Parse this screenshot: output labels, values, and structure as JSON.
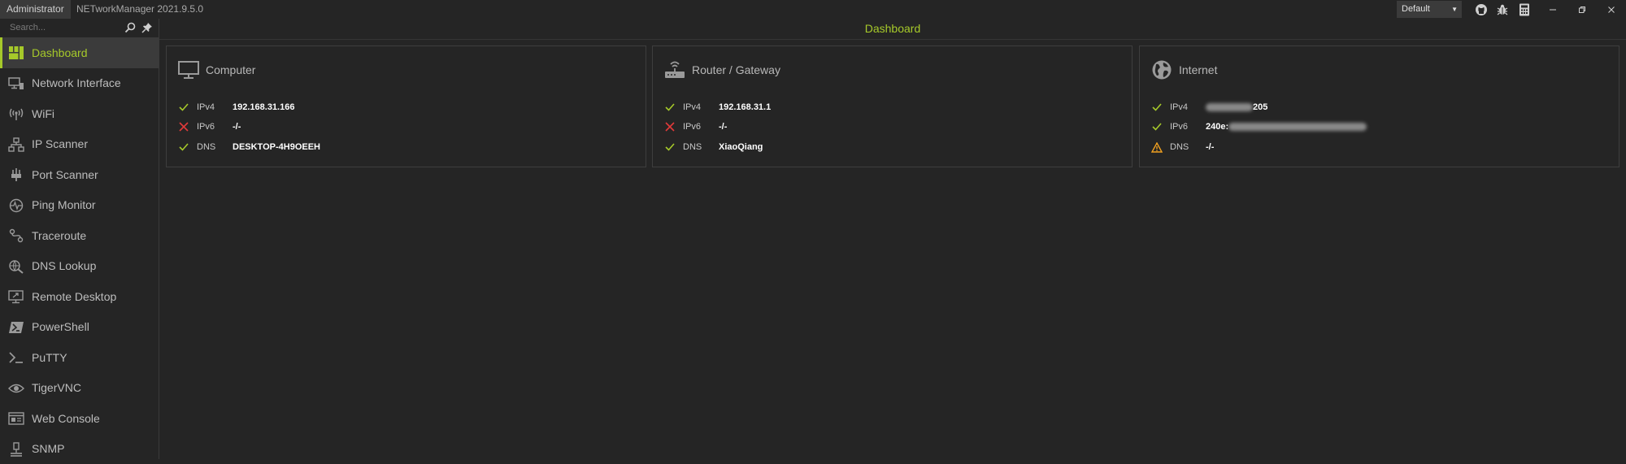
{
  "titlebar": {
    "user_badge": "Administrator",
    "app_title": "NETworkManager 2021.9.5.0",
    "profile_value": "Default",
    "icons": [
      "github-icon",
      "bug-icon",
      "calculator-icon"
    ],
    "window_buttons": [
      "minimize",
      "restore",
      "close"
    ]
  },
  "sidebar": {
    "search_placeholder": "Search...",
    "items": [
      {
        "label": "Dashboard",
        "icon": "dashboard-icon"
      },
      {
        "label": "Network Interface",
        "icon": "network-interface-icon"
      },
      {
        "label": "WiFi",
        "icon": "wifi-icon"
      },
      {
        "label": "IP Scanner",
        "icon": "ip-scanner-icon"
      },
      {
        "label": "Port Scanner",
        "icon": "port-scanner-icon"
      },
      {
        "label": "Ping Monitor",
        "icon": "ping-monitor-icon"
      },
      {
        "label": "Traceroute",
        "icon": "traceroute-icon"
      },
      {
        "label": "DNS Lookup",
        "icon": "dns-lookup-icon"
      },
      {
        "label": "Remote Desktop",
        "icon": "remote-desktop-icon"
      },
      {
        "label": "PowerShell",
        "icon": "powershell-icon"
      },
      {
        "label": "PuTTY",
        "icon": "putty-icon"
      },
      {
        "label": "TigerVNC",
        "icon": "tigervnc-icon"
      },
      {
        "label": "Web Console",
        "icon": "web-console-icon"
      },
      {
        "label": "SNMP",
        "icon": "snmp-icon"
      }
    ]
  },
  "main": {
    "title": "Dashboard",
    "cards": [
      {
        "title": "Computer",
        "icon": "monitor-icon",
        "rows": [
          {
            "label": "IPv4",
            "value": "192.168.31.166",
            "status": "ok"
          },
          {
            "label": "IPv6",
            "value": "-/-",
            "status": "error"
          },
          {
            "label": "DNS",
            "value": "DESKTOP-4H9OEEH",
            "status": "ok"
          }
        ]
      },
      {
        "title": "Router / Gateway",
        "icon": "router-icon",
        "rows": [
          {
            "label": "IPv4",
            "value": "192.168.31.1",
            "status": "ok"
          },
          {
            "label": "IPv6",
            "value": "-/-",
            "status": "error"
          },
          {
            "label": "DNS",
            "value": "XiaoQiang",
            "status": "ok"
          }
        ]
      },
      {
        "title": "Internet",
        "icon": "globe-icon",
        "rows": [
          {
            "label": "IPv4",
            "value": "205",
            "status": "ok"
          },
          {
            "label": "IPv6",
            "value": "240e:",
            "status": "ok"
          },
          {
            "label": "DNS",
            "value": "-/-",
            "status": "warning"
          }
        ]
      }
    ]
  },
  "colors": {
    "accent": "#a6c92a",
    "ok": "#a6c92a",
    "error": "#e03a3a",
    "warning": "#f0a020",
    "background": "#252525"
  }
}
